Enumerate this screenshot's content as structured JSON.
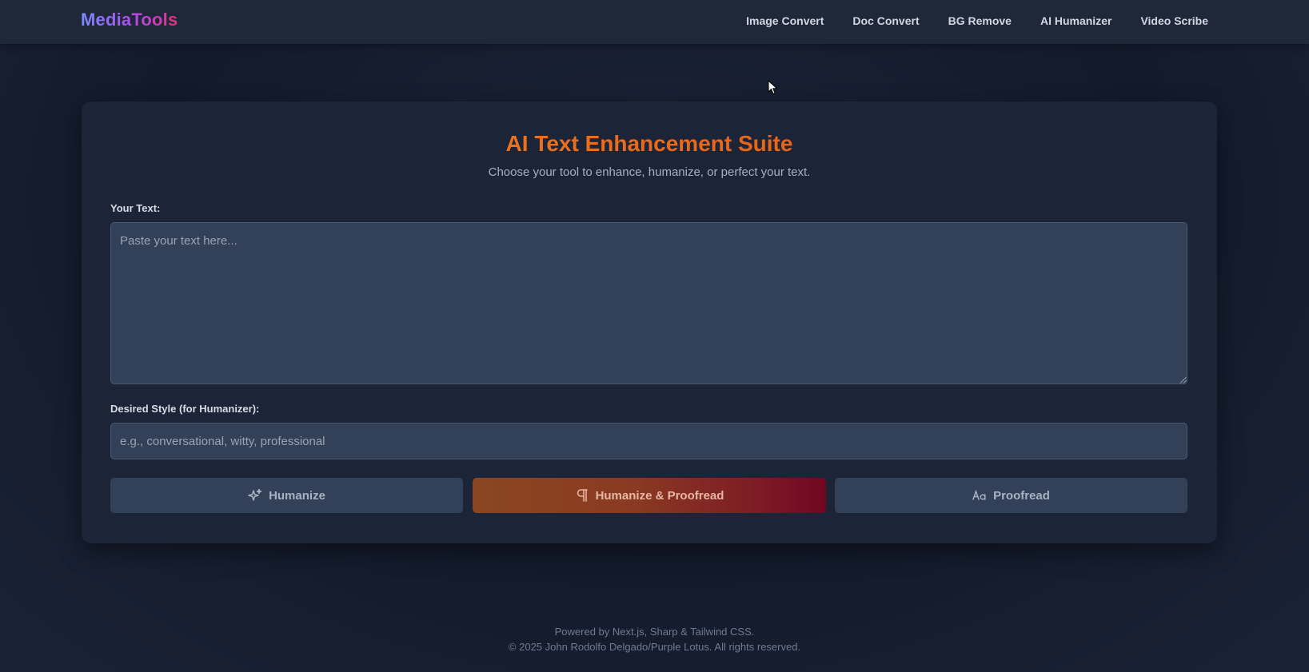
{
  "header": {
    "logo": "MediaTools",
    "nav": [
      {
        "label": "Image Convert"
      },
      {
        "label": "Doc Convert"
      },
      {
        "label": "BG Remove"
      },
      {
        "label": "AI Humanizer"
      },
      {
        "label": "Video Scribe"
      }
    ]
  },
  "main": {
    "title": "AI Text Enhancement Suite",
    "subtitle": "Choose your tool to enhance, humanize, or perfect your text.",
    "text_field": {
      "label": "Your Text:",
      "value": "",
      "placeholder": "Paste your text here..."
    },
    "style_field": {
      "label": "Desired Style (for Humanizer):",
      "value": "",
      "placeholder": "e.g., conversational, witty, professional"
    },
    "buttons": {
      "humanize": {
        "label": "Humanize",
        "icon": "sparkles-icon"
      },
      "humanize_proofread": {
        "label": "Humanize & Proofread",
        "icon": "pilcrow-icon"
      },
      "proofread": {
        "label": "Proofread",
        "icon": "text-case-icon"
      }
    }
  },
  "footer": {
    "line1": "Powered by Next.js, Sharp & Tailwind CSS.",
    "line2": "© 2025 John Rodolfo Delgado/Purple Lotus. All rights reserved."
  },
  "colors": {
    "background": "#141c2f",
    "card": "#1c2537",
    "input": "#334158",
    "title_gradient_start": "#f58a1f",
    "title_gradient_end": "#e05418",
    "primary_button_start": "#8a4621",
    "primary_button_end": "#720622"
  }
}
